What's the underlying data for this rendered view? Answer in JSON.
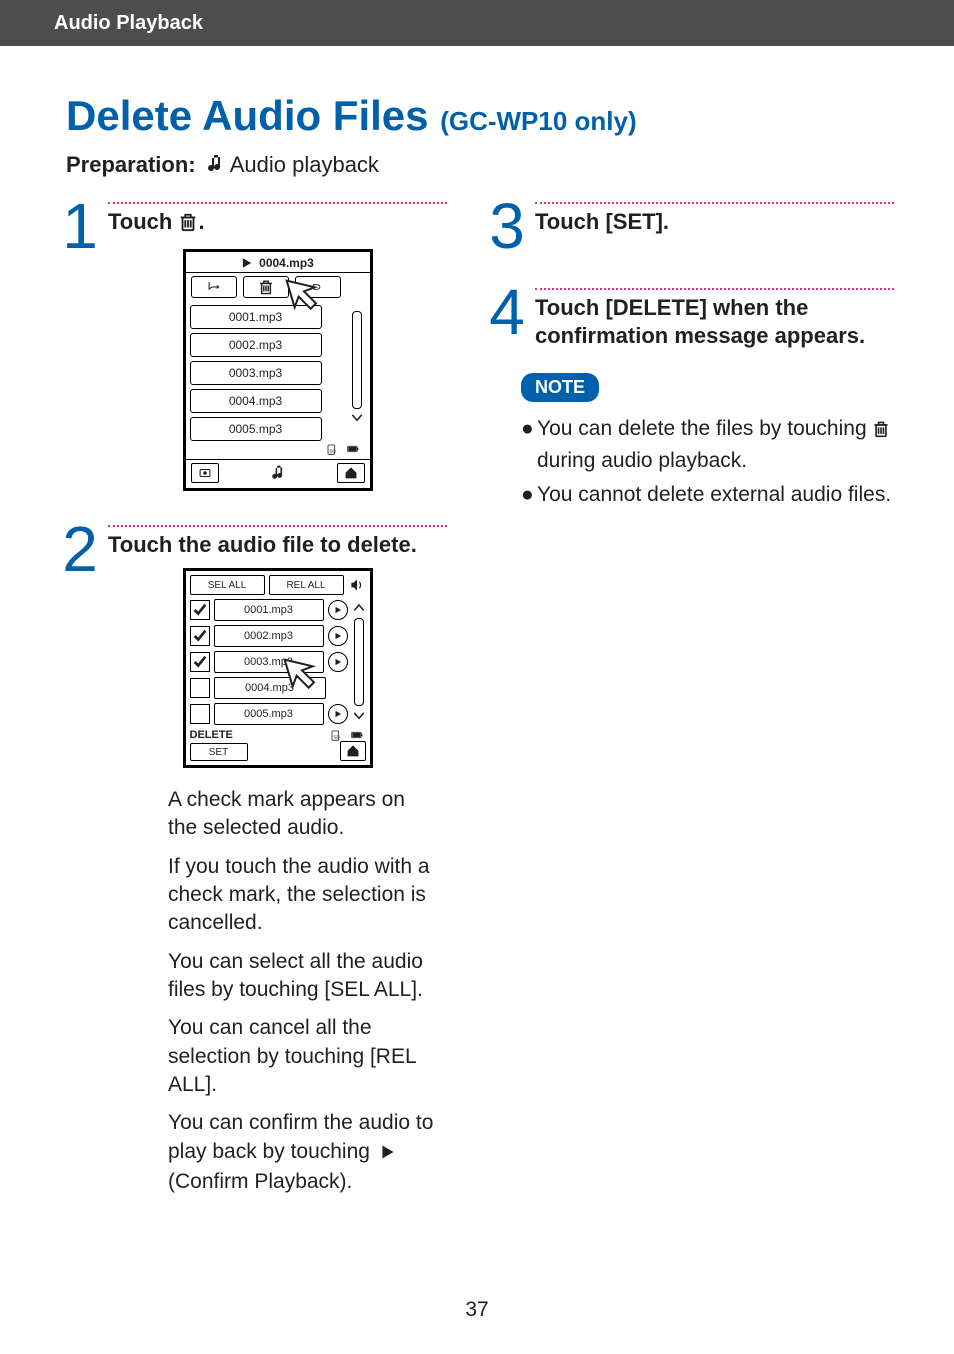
{
  "header": "Audio Playback",
  "title_main": "Delete Audio Files",
  "title_sub": "(GC-WP10 only)",
  "preparation_label": "Preparation:",
  "preparation_text": "Audio playback",
  "steps": {
    "1": {
      "text_before": "Touch",
      "text_after": "."
    },
    "2": {
      "text": "Touch the audio file to delete."
    },
    "3": {
      "text": "Touch [SET]."
    },
    "4": {
      "text": "Touch [DELETE] when the confirmation message appears."
    }
  },
  "screen1": {
    "now_playing": "0004.mp3",
    "items": [
      "0001.mp3",
      "0002.mp3",
      "0003.mp3",
      "0004.mp3",
      "0005.mp3"
    ]
  },
  "screen2": {
    "sel_all": "SEL ALL",
    "rel_all": "REL ALL",
    "delete_label": "DELETE",
    "set_label": "SET",
    "items": [
      {
        "name": "0001.mp3",
        "checked": true,
        "play": true
      },
      {
        "name": "0002.mp3",
        "checked": true,
        "play": true
      },
      {
        "name": "0003.mp3",
        "checked": true,
        "play": true
      },
      {
        "name": "0004.mp3",
        "checked": false,
        "play": false
      },
      {
        "name": "0005.mp3",
        "checked": false,
        "play": true
      }
    ]
  },
  "paras": {
    "p1": "A check mark appears on the selected audio.",
    "p2": "If you touch the audio with a check mark, the selection is cancelled.",
    "p3": "You can select all the audio files by touching [SEL ALL].",
    "p4": "You can cancel all the selection by touching [REL ALL].",
    "p5a": "You can confirm the audio to play back by touching",
    "p5b": "(Confirm Playback)."
  },
  "note": {
    "label": "NOTE",
    "b1a": "You can delete the files by touching",
    "b1b": "during audio playback.",
    "b2": "You cannot delete external audio files."
  },
  "page_number": "37"
}
